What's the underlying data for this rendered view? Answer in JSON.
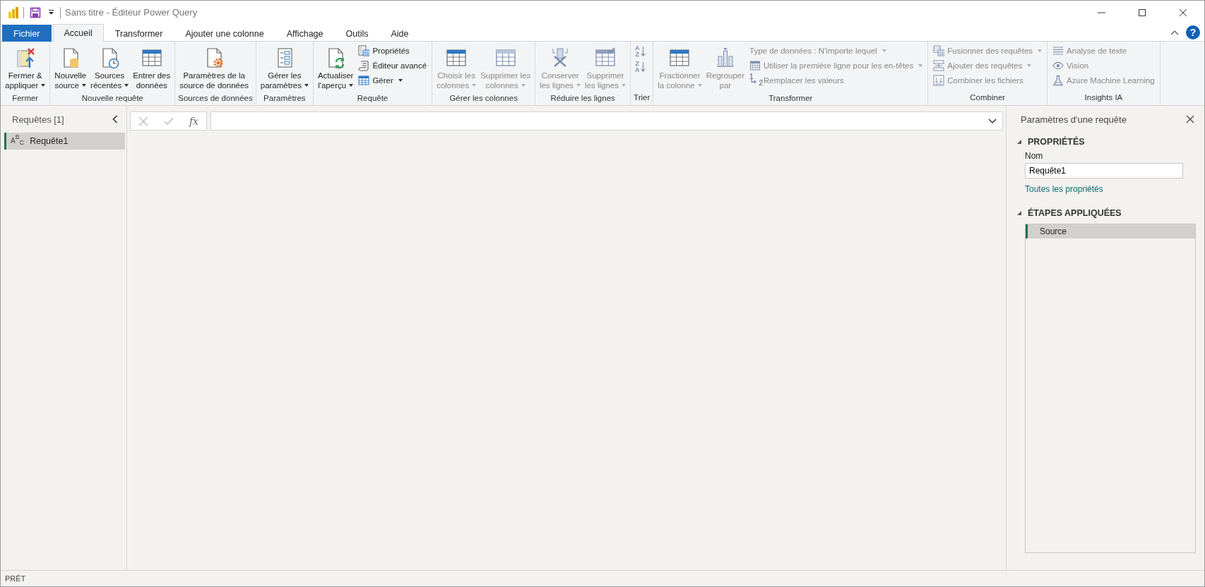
{
  "window": {
    "title": "Sans titre - Éditeur Power Query"
  },
  "tabs": [
    {
      "label": "Fichier",
      "kind": "file",
      "selected": false
    },
    {
      "label": "Accueil",
      "kind": "tab",
      "selected": true
    },
    {
      "label": "Transformer",
      "kind": "tab",
      "selected": false
    },
    {
      "label": "Ajouter une colonne",
      "kind": "tab",
      "selected": false
    },
    {
      "label": "Affichage",
      "kind": "tab",
      "selected": false
    },
    {
      "label": "Outils",
      "kind": "tab",
      "selected": false
    },
    {
      "label": "Aide",
      "kind": "tab",
      "selected": false
    }
  ],
  "help": "?",
  "ribbon": {
    "groups": [
      {
        "label": "Fermer",
        "items": [
          {
            "kind": "large",
            "lines": [
              "Fermer &",
              "appliquer"
            ],
            "dropdown": true,
            "disabled": false
          }
        ]
      },
      {
        "label": "Nouvelle requête",
        "items": [
          {
            "kind": "large",
            "lines": [
              "Nouvelle",
              "source"
            ],
            "dropdown": true,
            "disabled": false
          },
          {
            "kind": "large",
            "lines": [
              "Sources",
              "récentes"
            ],
            "dropdown": true,
            "disabled": false
          },
          {
            "kind": "large",
            "lines": [
              "Entrer des",
              "données"
            ],
            "dropdown": false,
            "disabled": false
          }
        ]
      },
      {
        "label": "Sources de données",
        "items": [
          {
            "kind": "large",
            "lines": [
              "Paramètres de la",
              "source de données"
            ],
            "dropdown": false,
            "disabled": false
          }
        ]
      },
      {
        "label": "Paramètres",
        "items": [
          {
            "kind": "large",
            "lines": [
              "Gérer les",
              "paramètres"
            ],
            "dropdown": true,
            "disabled": false
          }
        ]
      },
      {
        "label": "Requête",
        "items": [
          {
            "kind": "large",
            "lines": [
              "Actualiser",
              "l'aperçu"
            ],
            "dropdown": true,
            "disabled": false
          },
          {
            "kind": "stack",
            "buttons": [
              {
                "label": "Propriétés",
                "dropdown": false,
                "disabled": false
              },
              {
                "label": "Éditeur avancé",
                "dropdown": false,
                "disabled": false
              },
              {
                "label": "Gérer",
                "dropdown": true,
                "disabled": false
              }
            ]
          }
        ]
      },
      {
        "label": "Gérer les colonnes",
        "items": [
          {
            "kind": "large",
            "lines": [
              "Choisir les",
              "colonnes"
            ],
            "dropdown": true,
            "disabled": true
          },
          {
            "kind": "large",
            "lines": [
              "Supprimer les",
              "colonnes"
            ],
            "dropdown": true,
            "disabled": true
          }
        ]
      },
      {
        "label": "Réduire les lignes",
        "items": [
          {
            "kind": "large",
            "lines": [
              "Conserver",
              "les lignes"
            ],
            "dropdown": true,
            "disabled": true
          },
          {
            "kind": "large",
            "lines": [
              "Supprimer",
              "les lignes"
            ],
            "dropdown": true,
            "disabled": true
          }
        ]
      },
      {
        "label": "Trier",
        "items": [
          {
            "kind": "sort",
            "buttons": [
              {
                "letters": [
                  "A",
                  "Z"
                ],
                "disabled": true
              },
              {
                "letters": [
                  "Z",
                  "A"
                ],
                "disabled": true
              }
            ]
          }
        ]
      },
      {
        "label": "Transformer",
        "items": [
          {
            "kind": "large",
            "lines": [
              "Fractionner",
              "la colonne"
            ],
            "dropdown": true,
            "disabled": true
          },
          {
            "kind": "large",
            "lines": [
              "Regrouper",
              "par"
            ],
            "dropdown": false,
            "disabled": true
          },
          {
            "kind": "stack",
            "buttons": [
              {
                "label": "Type de données : N'importe lequel",
                "dropdown": true,
                "disabled": true
              },
              {
                "label": "Utiliser la première ligne pour les en-têtes",
                "dropdown": true,
                "disabled": true
              },
              {
                "label": "Remplacer les valeurs",
                "dropdown": false,
                "disabled": true,
                "icon_text": [
                  "1",
                  "2"
                ]
              }
            ]
          }
        ]
      },
      {
        "label": "Combiner",
        "items": [
          {
            "kind": "stack",
            "buttons": [
              {
                "label": "Fusionner des requêtes",
                "dropdown": true,
                "disabled": true
              },
              {
                "label": "Ajouter des requêtes",
                "dropdown": true,
                "disabled": true
              },
              {
                "label": "Combiner les fichiers",
                "dropdown": false,
                "disabled": true
              }
            ]
          }
        ]
      },
      {
        "label": "Insights IA",
        "items": [
          {
            "kind": "stack",
            "buttons": [
              {
                "label": "Analyse de texte",
                "dropdown": false,
                "disabled": true
              },
              {
                "label": "Vision",
                "dropdown": false,
                "disabled": true
              },
              {
                "label": "Azure Machine Learning",
                "dropdown": false,
                "disabled": true
              }
            ]
          }
        ]
      }
    ]
  },
  "queries": {
    "title": "Requêtes [1]",
    "items": [
      {
        "name": "Requête1",
        "type_letters": [
          "A",
          "B",
          "C"
        ],
        "selected": true
      }
    ]
  },
  "formula_bar": {
    "fx": "fx"
  },
  "settings": {
    "title": "Paramètres d'une requête",
    "properties": {
      "heading": "PROPRIÉTÉS",
      "expanded": true,
      "name_label": "Nom",
      "name_value": "Requête1",
      "link": "Toutes les propriétés"
    },
    "steps": {
      "heading": "ÉTAPES APPLIQUÉES",
      "expanded": true,
      "items": [
        {
          "name": "Source",
          "selected": true
        }
      ]
    }
  },
  "status_bar": "PRÊT"
}
